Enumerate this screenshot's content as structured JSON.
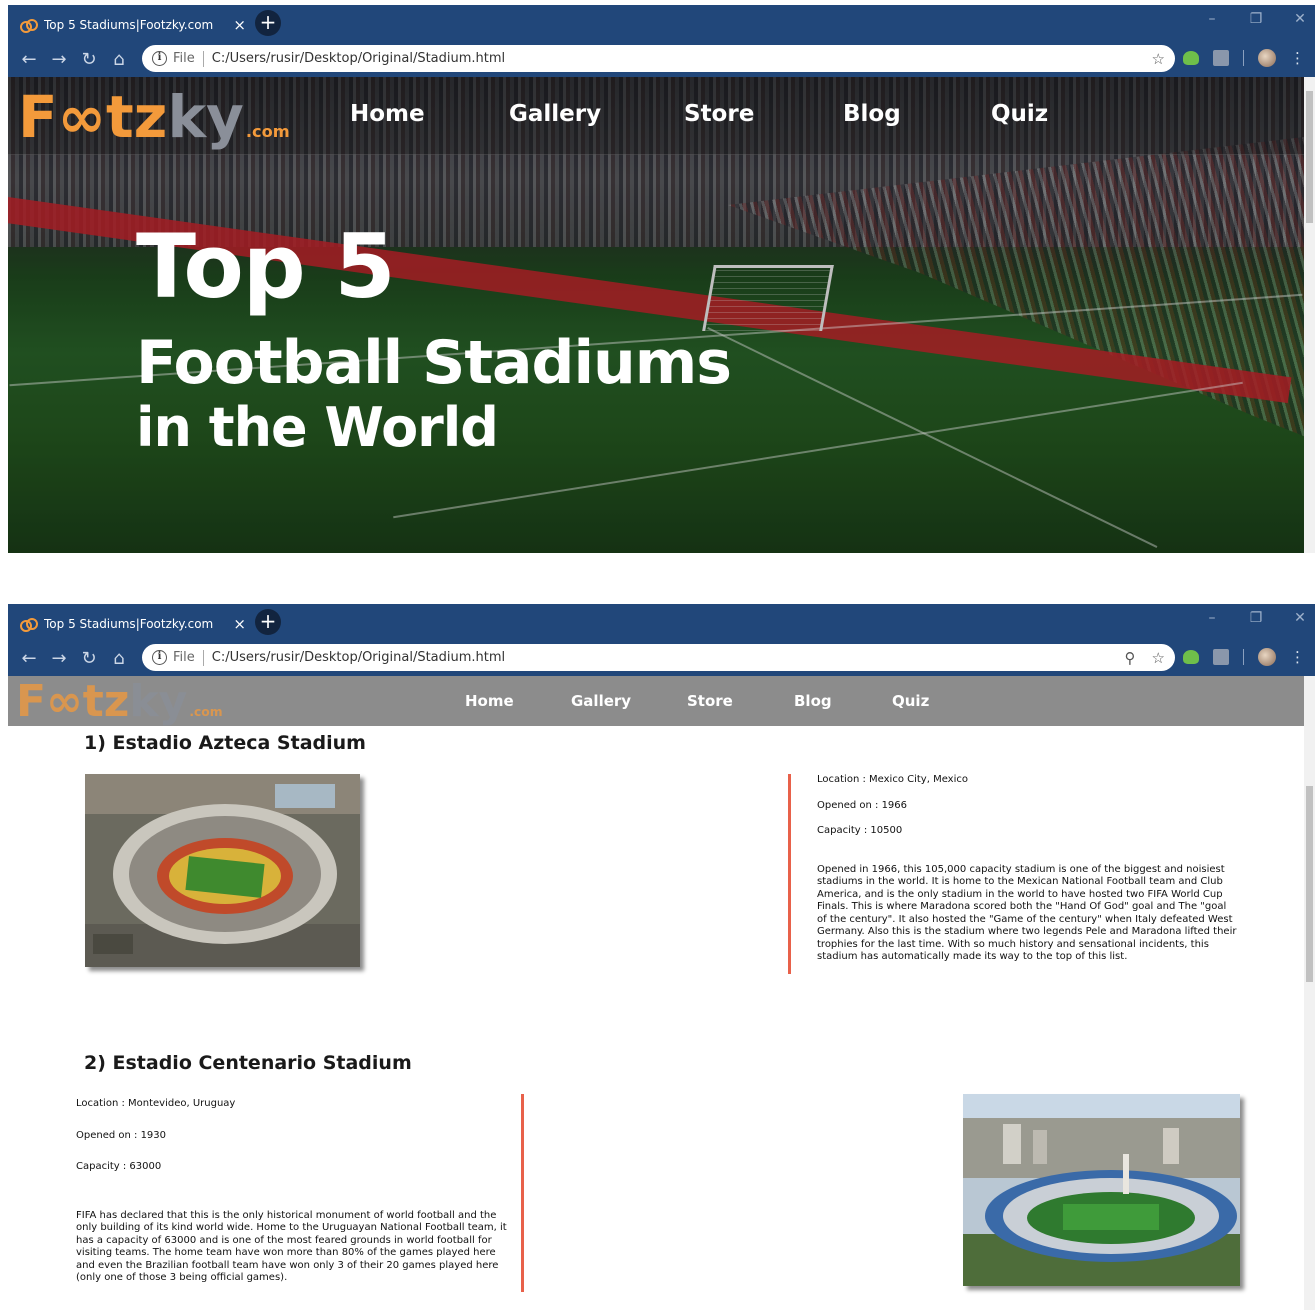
{
  "browser": {
    "tab_title": "Top 5 Stadiums|Footzky.com",
    "tab_close": "×",
    "new_tab": "+",
    "address_prefix": "File",
    "url": "C:/Users/rusir/Desktop/Original/Stadium.html",
    "win_minimize": "–",
    "win_restore": "❐",
    "win_close": "✕"
  },
  "logo": {
    "f": "F",
    "oo": "∞",
    "tz": "tz",
    "ky": "ky",
    "com": ".com"
  },
  "nav": {
    "items": [
      {
        "label": "Home"
      },
      {
        "label": "Gallery"
      },
      {
        "label": "Store"
      },
      {
        "label": "Blog"
      },
      {
        "label": "Quiz"
      }
    ]
  },
  "hero": {
    "line1": "Top 5",
    "line2": "Football Stadiums",
    "line3": "in the World"
  },
  "stadiums": [
    {
      "title": "1) Estadio Azteca Stadium",
      "location": "Location : Mexico City, Mexico",
      "opened": "Opened on : 1966",
      "capacity": "Capacity : 10500",
      "description": "Opened in 1966, this 105,000 capacity stadium is one of the biggest and noisiest stadiums in the world. It is home to the Mexican National Football team and Club America, and is the only stadium in the world to have hosted two FIFA World Cup Finals. This is where Maradona scored both the \"Hand Of God\" goal and The \"goal of the century\". It also hosted the \"Game of the century\" when Italy defeated West Germany. Also this is the stadium where two legends Pele and Maradona lifted their trophies for the last time. With so much history and sensational incidents, this stadium has automatically made its way to the top of this list."
    },
    {
      "title": "2) Estadio Centenario Stadium",
      "location": "Location : Montevideo, Uruguay",
      "opened": "Opened on : 1930",
      "capacity": "Capacity : 63000",
      "description": "FIFA has declared that this is the only historical monument of world football and the only building of its kind world wide. Home to the Uruguayan National Football team, it has a capacity of 63000 and is one of the most feared grounds in world football for visiting teams. The home team have won more than 80% of the games played here and even the Brazilian football team have won only 3 of their 20 games played here (only one of those 3 being official games)."
    }
  ],
  "colors": {
    "chrome": "#21477a",
    "accent_orange": "#f39a3b",
    "divider": "#e8614a",
    "nav_gray": "#8c8c8c"
  }
}
